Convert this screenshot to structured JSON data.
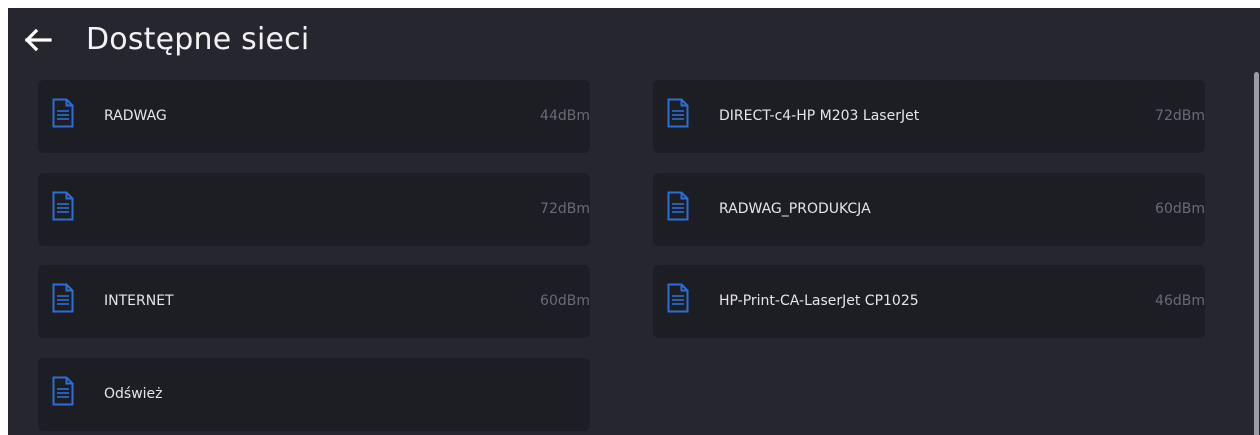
{
  "header": {
    "title": "Dostępne sieci"
  },
  "networks": [
    {
      "name": "RADWAG",
      "signal": "44dBm"
    },
    {
      "name": "DIRECT-c4-HP M203 LaserJet",
      "signal": "72dBm"
    },
    {
      "name": "",
      "signal": "72dBm"
    },
    {
      "name": "RADWAG_PRODUKCJA",
      "signal": "60dBm"
    },
    {
      "name": "INTERNET",
      "signal": "60dBm"
    },
    {
      "name": "HP-Print-CA-LaserJet CP1025",
      "signal": "46dBm"
    }
  ],
  "refresh": {
    "label": "Odśwież"
  },
  "icons": {
    "back": "arrow-left-icon",
    "item": "document-icon"
  },
  "colors": {
    "background": "#26262f",
    "tile": "#1d1d24",
    "accent": "#2b6fd6",
    "text": "#e6e6e6",
    "signal": "#6a6a76"
  }
}
